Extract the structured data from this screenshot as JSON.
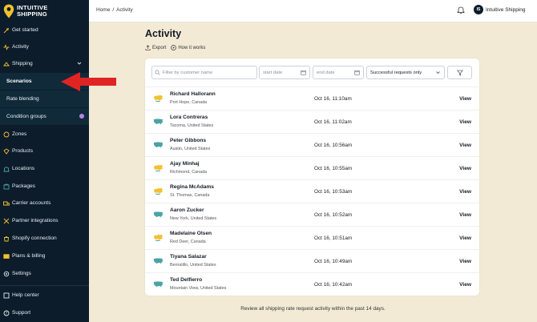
{
  "brand": {
    "line1": "INTUITIVE",
    "line2": "SHIPPING"
  },
  "colors": {
    "sidebar_bg": "#0c1c2b",
    "page_bg": "#f3ead6",
    "accent_yellow": "#f2c12e",
    "accent_teal": "#4aa3a6",
    "badge_purple": "#b883e6",
    "arrow_red": "#e02424"
  },
  "sidebar": {
    "items": [
      {
        "label": "Get started",
        "icon": "rocket-icon"
      },
      {
        "label": "Activity",
        "icon": "pulse-icon"
      },
      {
        "label": "Shipping",
        "icon": "shipping-icon",
        "expanded": true
      },
      {
        "label": "Scenarios",
        "sub": true,
        "active": true
      },
      {
        "label": "Rate blending",
        "sub": true
      },
      {
        "label": "Condition groups",
        "sub": true,
        "badge": "i"
      },
      {
        "label": "Zones",
        "icon": "zones-icon"
      },
      {
        "label": "Products",
        "icon": "products-icon"
      },
      {
        "label": "Locations",
        "icon": "locations-icon"
      },
      {
        "label": "Packages",
        "icon": "packages-icon"
      },
      {
        "label": "Carrier accounts",
        "icon": "carrier-icon"
      },
      {
        "label": "Partner integrations",
        "icon": "integrations-icon"
      },
      {
        "label": "Shopify connection",
        "icon": "shopify-icon"
      },
      {
        "label": "Plans & billing",
        "icon": "billing-icon"
      },
      {
        "label": "Settings",
        "icon": "settings-icon"
      },
      {
        "label": "Help center",
        "icon": "help-icon"
      },
      {
        "label": "Support",
        "icon": "support-icon"
      }
    ]
  },
  "topbar": {
    "breadcrumb": {
      "home": "Home",
      "sep": "/",
      "current": "Activity"
    },
    "avatar_initials": "IS",
    "account_name": "Intuitive Shipping"
  },
  "page": {
    "title": "Activity",
    "export_label": "Export",
    "how_it_works_label": "How it works"
  },
  "filters": {
    "search_placeholder": "Filter by customer name",
    "start_date_placeholder": "start date",
    "end_date_placeholder": "end date",
    "status_value": "Successful requests only"
  },
  "rows": [
    {
      "name": "Richard Hallorann",
      "location": "Port Hope, Canada",
      "date": "Oct 16, 11:10am",
      "flag": "canada",
      "action": "View"
    },
    {
      "name": "Lora Contreras",
      "location": "Tacoma, United States",
      "date": "Oct 16, 11:02am",
      "flag": "usa",
      "action": "View"
    },
    {
      "name": "Peter Gibbons",
      "location": "Austin, United States",
      "date": "Oct 16, 10:56am",
      "flag": "usa",
      "action": "View"
    },
    {
      "name": "Ajay Minhaj",
      "location": "Richmond, Canada",
      "date": "Oct 16, 10:55am",
      "flag": "canada",
      "action": "View"
    },
    {
      "name": "Regina McAdams",
      "location": "St. Thomas, Canada",
      "date": "Oct 16, 10:53am",
      "flag": "canada",
      "action": "View"
    },
    {
      "name": "Aaron Zucker",
      "location": "New York, United States",
      "date": "Oct 16, 10:52am",
      "flag": "usa",
      "action": "View"
    },
    {
      "name": "Madelaine Olsen",
      "location": "Red Deer, Canada",
      "date": "Oct 16, 10:51am",
      "flag": "canada",
      "action": "View"
    },
    {
      "name": "Tiyana Salazar",
      "location": "Bernalillo, United States",
      "date": "Oct 16, 10:49am",
      "flag": "usa",
      "action": "View"
    },
    {
      "name": "Ted Delfierro",
      "location": "Mountain View, United States",
      "date": "Oct 16, 10:42am",
      "flag": "usa",
      "action": "View"
    }
  ],
  "footer_note": "Review all shipping rate request activity within the past 14 days."
}
